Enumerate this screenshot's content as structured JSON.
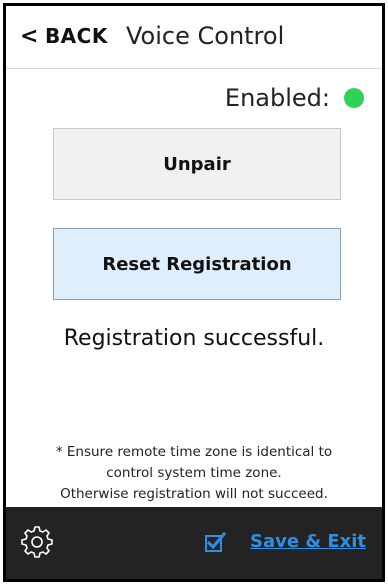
{
  "header": {
    "back_label": "BACK",
    "back_chevron": "<",
    "title": "Voice Control"
  },
  "status": {
    "label": "Enabled:",
    "indicator_color": "#2fd15a"
  },
  "buttons": {
    "unpair_label": "Unpair",
    "reset_label": "Reset Registration"
  },
  "result_text": "Registration successful.",
  "note": {
    "line1": "* Ensure remote time zone is identical to",
    "line2": "control system time zone.",
    "line3": "Otherwise registration will not succeed."
  },
  "footer": {
    "settings_icon": "gear-icon",
    "checkbox_icon": "checkbox-checked-icon",
    "save_exit_label": "Save & Exit",
    "accent_color": "#2b90e6"
  }
}
